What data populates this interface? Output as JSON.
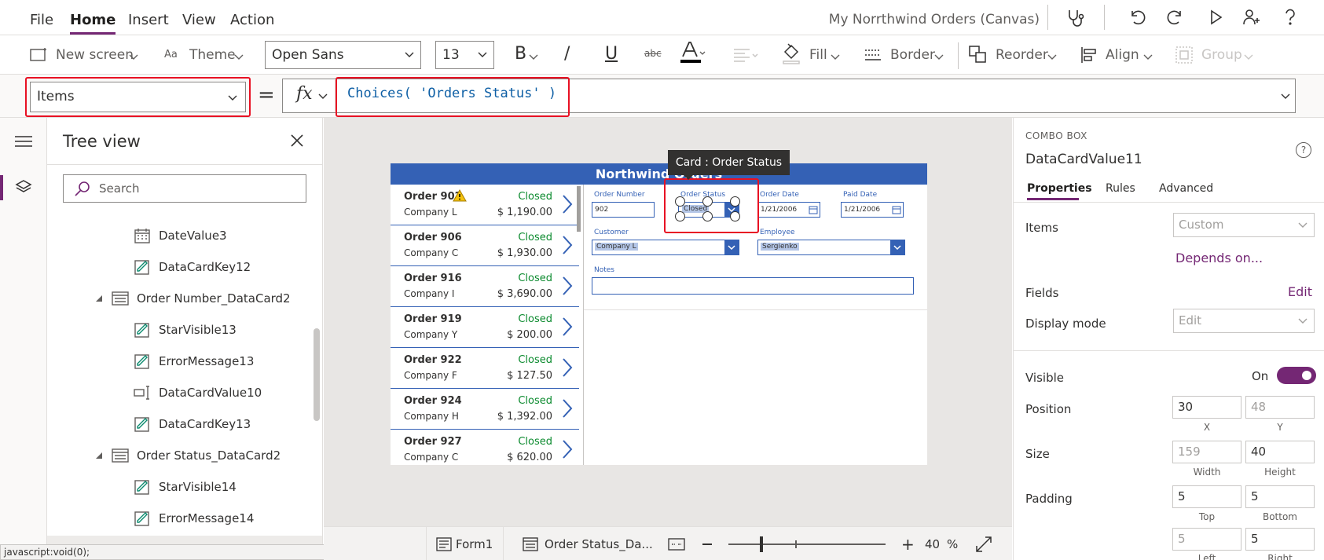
{
  "menu": {
    "file": "File",
    "home": "Home",
    "insert": "Insert",
    "view": "View",
    "action": "Action",
    "app_title": "My Norrthwind Orders (Canvas)"
  },
  "ribbon": {
    "new_screen": "New screen",
    "theme": "Theme",
    "font": "Open Sans",
    "font_size": "13",
    "fill": "Fill",
    "border": "Border",
    "reorder": "Reorder",
    "align": "Align",
    "group": "Group"
  },
  "formula": {
    "property": "Items",
    "equals": "=",
    "fx": "fx",
    "expression": "Choices( 'Orders Status' )"
  },
  "tree": {
    "title": "Tree view",
    "search_placeholder": "Search",
    "items": [
      {
        "label": "DateValue3"
      },
      {
        "label": "DataCardKey12"
      },
      {
        "label": "Order Number_DataCard2"
      },
      {
        "label": "StarVisible13"
      },
      {
        "label": "ErrorMessage13"
      },
      {
        "label": "DataCardValue10"
      },
      {
        "label": "DataCardKey13"
      },
      {
        "label": "Order Status_DataCard2"
      },
      {
        "label": "StarVisible14"
      },
      {
        "label": "ErrorMessage14"
      }
    ],
    "status_url": "javascript:void(0);"
  },
  "app": {
    "header": "Northwind Orders",
    "tooltip": "Card : Order Status",
    "orders": [
      {
        "num": "Order 902",
        "company": "Company L",
        "status": "Closed",
        "amount": "$ 1,190.00"
      },
      {
        "num": "Order 906",
        "company": "Company C",
        "status": "Closed",
        "amount": "$ 1,930.00"
      },
      {
        "num": "Order 916",
        "company": "Company I",
        "status": "Closed",
        "amount": "$ 3,690.00"
      },
      {
        "num": "Order 919",
        "company": "Company Y",
        "status": "Closed",
        "amount": "$ 200.00"
      },
      {
        "num": "Order 922",
        "company": "Company F",
        "status": "Closed",
        "amount": "$ 127.50"
      },
      {
        "num": "Order 924",
        "company": "Company H",
        "status": "Closed",
        "amount": "$ 1,392.00"
      },
      {
        "num": "Order 927",
        "company": "Company C",
        "status": "Closed",
        "amount": "$ 620.00"
      }
    ],
    "form": {
      "order_number_label": "Order Number",
      "order_number": "902",
      "order_status_label": "Order Status",
      "order_status": "Closed",
      "order_date_label": "Order Date",
      "order_date": "1/21/2006",
      "paid_date_label": "Paid Date",
      "paid_date": "1/21/2006",
      "customer_label": "Customer",
      "customer": "Company L",
      "employee_label": "Employee",
      "employee": "Sergienko",
      "notes_label": "Notes"
    }
  },
  "bottom": {
    "form": "Form1",
    "card": "Order Status_Da...",
    "zoom": "40",
    "percent": "%"
  },
  "props": {
    "type": "COMBO BOX",
    "name": "DataCardValue11",
    "tabs": [
      "Properties",
      "Rules",
      "Advanced"
    ],
    "items_label": "Items",
    "items_value": "Custom",
    "depends_on": "Depends on...",
    "fields_label": "Fields",
    "fields_edit": "Edit",
    "display_mode_label": "Display mode",
    "display_mode_value": "Edit",
    "visible_label": "Visible",
    "visible_value": "On",
    "position_label": "Position",
    "pos_x": "30",
    "pos_y": "48",
    "x_label": "X",
    "y_label": "Y",
    "size_label": "Size",
    "width": "159",
    "height": "40",
    "width_label": "Width",
    "height_label": "Height",
    "padding_label": "Padding",
    "pad_top": "5",
    "pad_bottom": "5",
    "top_label": "Top",
    "bottom_label": "Bottom",
    "pad_left": "5",
    "pad_right": "5",
    "left_label": "Left",
    "right_label": "Right"
  },
  "colors": {
    "accent": "#742774",
    "app_blue": "#3461b5",
    "status_green": "#0b8a2e",
    "highlight_red": "#e81123"
  }
}
